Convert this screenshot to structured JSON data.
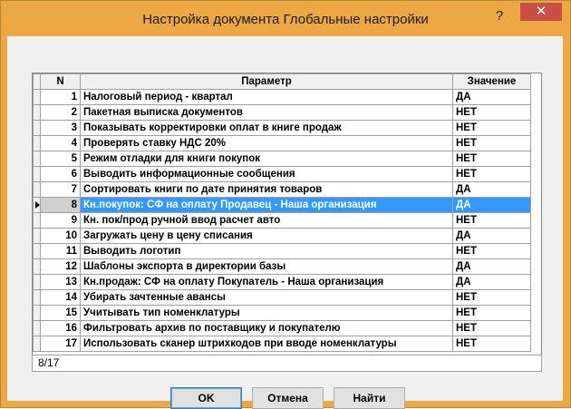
{
  "window": {
    "title": "Настройка документа Глобальные настройки",
    "help": "?",
    "close": "✕"
  },
  "grid": {
    "columns": [
      "N",
      "Параметр",
      "Значение"
    ],
    "rows": [
      {
        "n": "1",
        "param": "Налоговый период - квартал",
        "value": "ДА"
      },
      {
        "n": "2",
        "param": "Пакетная выписка документов",
        "value": "НЕТ"
      },
      {
        "n": "3",
        "param": "Показывать корректировки оплат в книге продаж",
        "value": "НЕТ"
      },
      {
        "n": "4",
        "param": "Проверять ставку НДС 20%",
        "value": "НЕТ"
      },
      {
        "n": "5",
        "param": "Режим отладки для книги покупок",
        "value": "НЕТ"
      },
      {
        "n": "6",
        "param": "Выводить информационные сообщения",
        "value": "НЕТ"
      },
      {
        "n": "7",
        "param": "Сортировать книги по дате принятия товаров",
        "value": "ДА"
      },
      {
        "n": "8",
        "param": "Кн.покупок: СФ на оплату Продавец - Наша организация",
        "value": "ДА"
      },
      {
        "n": "9",
        "param": "Кн. пок/прод ручной ввод расчет авто",
        "value": "НЕТ"
      },
      {
        "n": "10",
        "param": "Загружать цену в цену списания",
        "value": "ДА"
      },
      {
        "n": "11",
        "param": "Выводить логотип",
        "value": "НЕТ"
      },
      {
        "n": "12",
        "param": "Шаблоны экспорта в директории базы",
        "value": "ДА"
      },
      {
        "n": "13",
        "param": "Кн.продаж: СФ на оплату Покупатель - Наша организация",
        "value": "ДА"
      },
      {
        "n": "14",
        "param": "Убирать зачтенные авансы",
        "value": "НЕТ"
      },
      {
        "n": "15",
        "param": "Учитывать тип номенклатуры",
        "value": "НЕТ"
      },
      {
        "n": "16",
        "param": "Фильтровать архив по поставщику и покупателю",
        "value": "НЕТ"
      },
      {
        "n": "17",
        "param": "Использовать сканер штрихкодов при вводе номенклатуры",
        "value": "НЕТ"
      }
    ],
    "selected_row": 8
  },
  "status": {
    "position": "8/17"
  },
  "buttons": {
    "ok": "OK",
    "cancel": "Отмена",
    "find": "Найти"
  },
  "colors": {
    "frame": "#eba844",
    "selection": "#3399ff",
    "close": "#c74f46"
  }
}
